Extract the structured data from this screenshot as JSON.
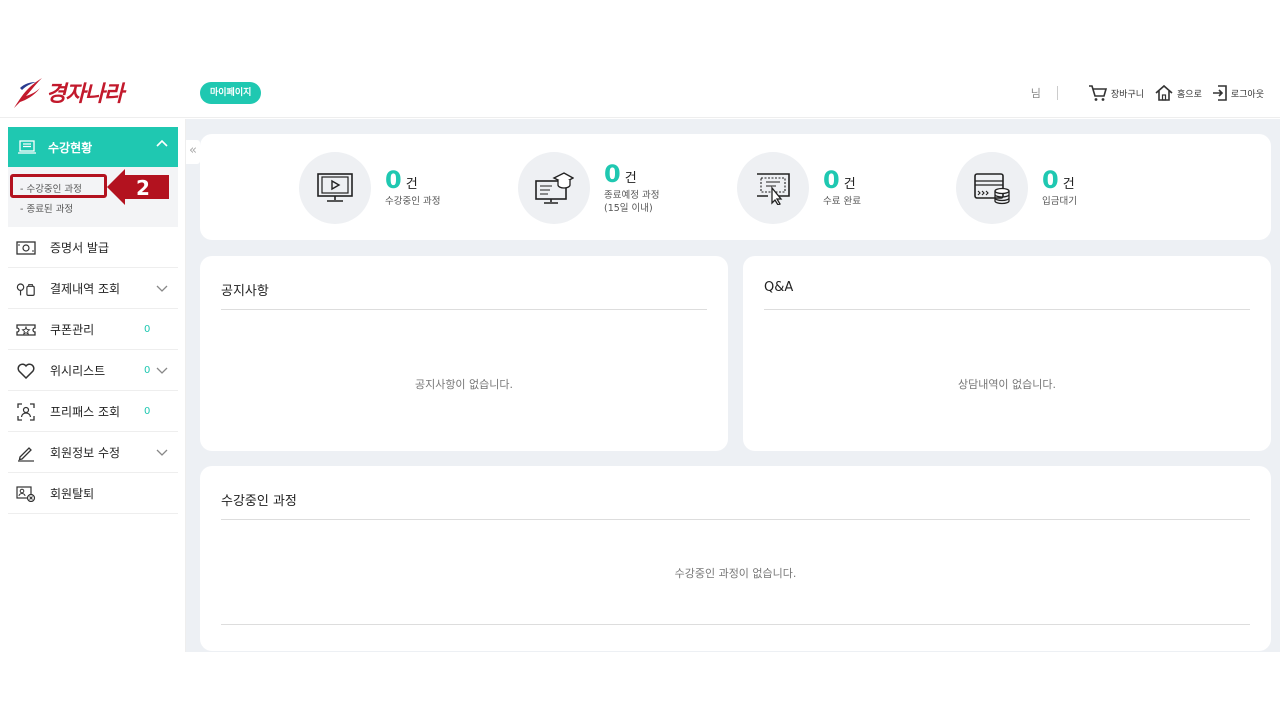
{
  "header": {
    "logo_text": "경자나라",
    "mypage_label": "마이페이지",
    "user_name": "님",
    "cart_label": "장바구니",
    "home_label": "홈으로",
    "logout_label": "로그아웃"
  },
  "sidebar": {
    "active_section": "수강현황",
    "sub_items": [
      "- 수강중인 과정",
      "- 종료된 과정"
    ],
    "annotation_number": "2",
    "items": [
      {
        "label": "증명서 발급",
        "count": ""
      },
      {
        "label": "결제내역 조회",
        "count": ""
      },
      {
        "label": "쿠폰관리",
        "count": "0"
      },
      {
        "label": "위시리스트",
        "count": "0"
      },
      {
        "label": "프리패스 조회",
        "count": "0"
      },
      {
        "label": "회원정보 수정",
        "count": ""
      },
      {
        "label": "회원탈퇴",
        "count": ""
      }
    ],
    "collapse_glyph": "«"
  },
  "stats": [
    {
      "value": "0",
      "unit": "건",
      "label": "수강중인 과정"
    },
    {
      "value": "0",
      "unit": "건",
      "label": "종료예정 과정\n(15일 이내)"
    },
    {
      "value": "0",
      "unit": "건",
      "label": "수료 완료"
    },
    {
      "value": "0",
      "unit": "건",
      "label": "입금대기"
    }
  ],
  "notice": {
    "title": "공지사항",
    "empty": "공지사항이 없습니다."
  },
  "qna": {
    "title": "Q&A",
    "empty": "상담내역이 없습니다."
  },
  "courses": {
    "title": "수강중인 과정",
    "empty": "수강중인 과정이 없습니다."
  },
  "colors": {
    "accent": "#1fc8b1",
    "brand": "#c2192c",
    "annotation": "#b3121f"
  }
}
